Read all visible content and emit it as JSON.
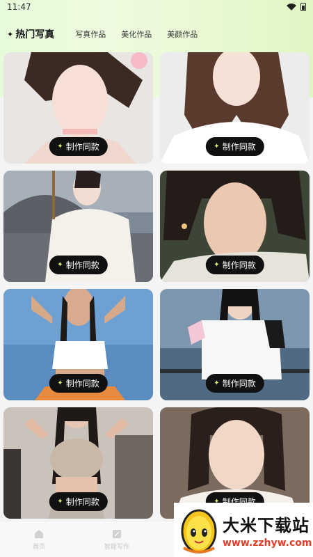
{
  "status_bar": {
    "time": "11:47"
  },
  "tabs": [
    {
      "label": "热门写真",
      "active": true
    },
    {
      "label": "写真作品",
      "active": false
    },
    {
      "label": "美化作品",
      "active": false
    },
    {
      "label": "美颜作品",
      "active": false
    }
  ],
  "cards": [
    {
      "button_label": "制作同款"
    },
    {
      "button_label": "制作同款"
    },
    {
      "button_label": "制作同款"
    },
    {
      "button_label": "制作同款"
    },
    {
      "button_label": "制作同款"
    },
    {
      "button_label": "制作同款"
    },
    {
      "button_label": "制作同款"
    },
    {
      "button_label": "制作同款"
    }
  ],
  "bottom_nav": [
    {
      "label": "首页",
      "icon": "home-icon"
    },
    {
      "label": "智能写作",
      "icon": "edit-icon"
    }
  ],
  "watermark": {
    "title": "大米下载站",
    "url": "www.zzhyw.com"
  },
  "colors": {
    "accent": "#e8f26a",
    "button_bg": "#111111",
    "watermark_url": "#e0402a"
  }
}
